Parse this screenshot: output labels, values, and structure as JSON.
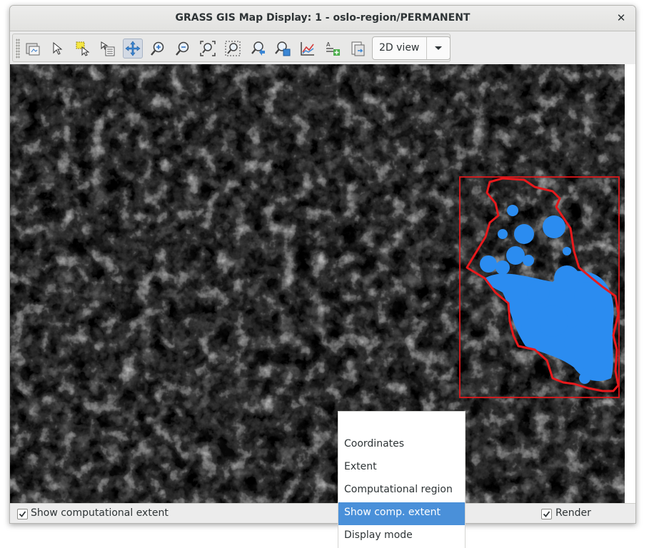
{
  "window": {
    "title": "GRASS GIS Map Display: 1 - oslo-region/PERMANENT",
    "close_glyph": "✕"
  },
  "toolbar": {
    "tools": [
      {
        "name": "render-map-icon"
      },
      {
        "name": "pointer-icon"
      },
      {
        "name": "select-icon"
      },
      {
        "name": "query-icon"
      },
      {
        "name": "pan-icon",
        "active": true
      },
      {
        "name": "zoom-in-icon"
      },
      {
        "name": "zoom-out-icon"
      },
      {
        "name": "zoom-extent-icon"
      },
      {
        "name": "zoom-region-icon"
      },
      {
        "name": "zoom-back-icon"
      },
      {
        "name": "zoom-menu-icon"
      },
      {
        "name": "analyze-icon"
      },
      {
        "name": "overlay-icon"
      },
      {
        "name": "save-icon"
      }
    ],
    "view_mode": "2D view"
  },
  "statusbar": {
    "show_extent_label": "Show computational extent",
    "show_extent_checked": true,
    "render_label": "Render",
    "render_checked": true
  },
  "menu": {
    "items": [
      {
        "label": "Coordinates",
        "selected": false
      },
      {
        "label": "Extent",
        "selected": false
      },
      {
        "label": "Computational region",
        "selected": false
      },
      {
        "label": "Show comp. extent",
        "selected": true
      },
      {
        "label": "Display mode",
        "selected": false
      }
    ]
  },
  "colors": {
    "region_outline": "#e8191c",
    "water_fill": "#2b8cf0",
    "selection": "#4a90d9"
  }
}
